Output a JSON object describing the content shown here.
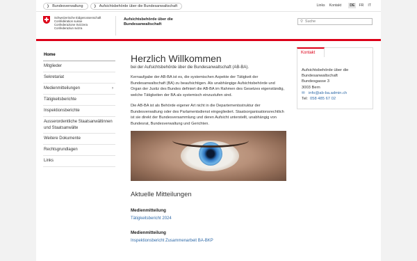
{
  "topbar": {
    "breadcrumbs": [
      {
        "label": "Bundesverwaltung"
      },
      {
        "label": "Aufsichtsbehörde über die Bundesanwaltschaft"
      }
    ],
    "links": [
      "Links",
      "Kontakt"
    ],
    "languages": [
      "DE",
      "FR",
      "IT"
    ],
    "active_language": "DE"
  },
  "header": {
    "confederation": [
      "Schweizerische Eidgenossenschaft",
      "Confédération suisse",
      "Confederazione Svizzera",
      "Confederaziun svizra"
    ],
    "authority": "Aufsichtsbehörde über die Bundesanwaltschaft",
    "search_placeholder": "Suche",
    "accent": "#dc0018"
  },
  "nav": {
    "items": [
      {
        "label": "Home"
      },
      {
        "label": "Mitglieder"
      },
      {
        "label": "Sekretariat"
      },
      {
        "label": "Medienmitteilungen"
      },
      {
        "label": "Tätigkeitsberichte"
      },
      {
        "label": "Inspektionsberichte"
      },
      {
        "label": "Ausserordentliche Staatsanwältinnen und Staatsanwälte"
      },
      {
        "label": "Weitere Dokumente"
      },
      {
        "label": "Rechtsgrundlagen"
      },
      {
        "label": "Links"
      }
    ]
  },
  "main": {
    "title": "Herzlich Willkommen",
    "lead": "bei der Aufsichtsbehörde über die Bundesanwaltschaft (AB-BA).",
    "paragraphs": [
      "Kernaufgabe der AB-BA ist es, die systemischen Aspekte der Tätigkeit der Bundesanwaltschaft (BA) zu beaufsichtigen. Als unabhängige Aufsichtsbehörde und Organ der Justiz des Bundes definiert die AB-BA im Rahmen des Gesetzes eigenständig, welche Tätigkeiten der BA als systemisch einzustufen sind.",
      "Die AB-BA ist als Behörde eigener Art nicht in die Departementsstruktur der Bundesverwaltung oder des Parlamentsdienst eingegliedert. Staatsorganisationsrechtlich ist sie direkt der Bundesversammlung und deren Aufsicht unterstellt, unabhängig von Bundesrat, Bundesverwaltung und Gerichten."
    ],
    "news_heading": "Aktuelle Mitteilungen",
    "news": [
      {
        "category": "Medienmitteilung",
        "link": "Tätigkeitsbericht 2024"
      },
      {
        "category": "Medienmitteilung",
        "link": "Inspektionsbericht Zusammenarbeit BA-BKP"
      }
    ]
  },
  "contact": {
    "tab": "Kontakt",
    "name": "Aufsichtsbehörde über die Bundesanwaltschaft",
    "street": "Bundesgasse 3",
    "city": "3003 Bern",
    "email": "info@ab-ba.admin.ch",
    "phone_label": "Tel:",
    "phone": "058 485 67 02"
  }
}
